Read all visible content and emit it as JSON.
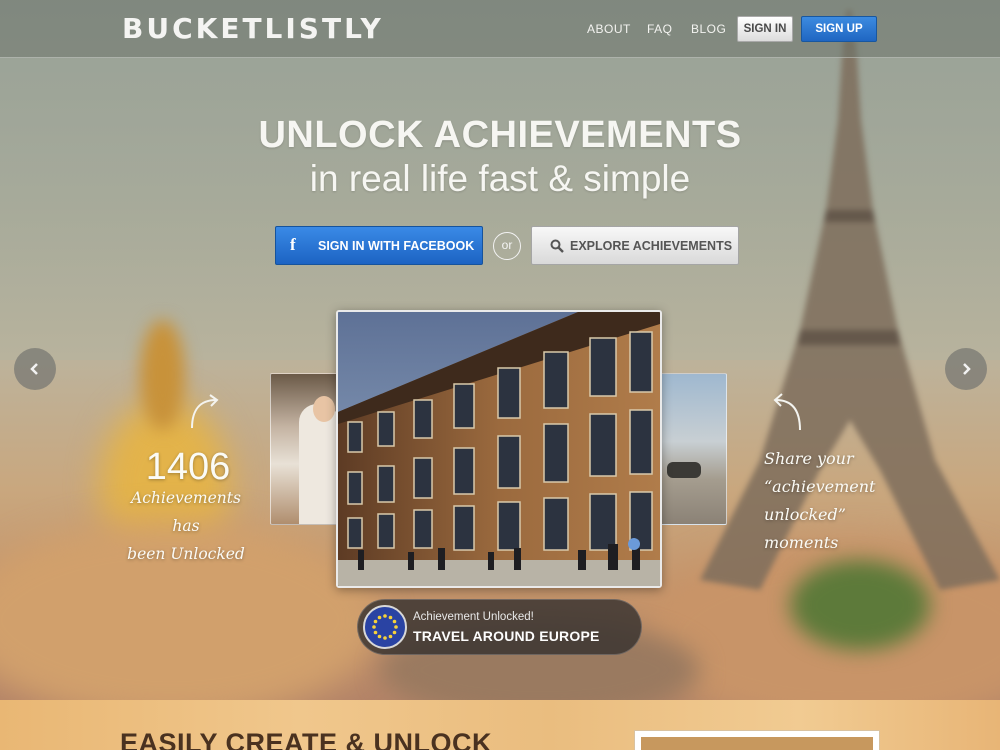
{
  "header": {
    "logo": "BUCKETLISTLY",
    "nav": [
      {
        "label": "ABOUT"
      },
      {
        "label": "FAQ"
      },
      {
        "label": "BLOG"
      }
    ],
    "sign_in": "SIGN IN",
    "sign_up": "SIGN UP"
  },
  "hero": {
    "title": "UNLOCK ACHIEVEMENTS",
    "subtitle": "in real life fast & simple",
    "facebook_button": "SIGN IN WITH FACEBOOK",
    "or": "or",
    "explore_button": "EXPLORE ACHIEVEMENTS"
  },
  "stats": {
    "count": "1406",
    "caption_line1": "Achievements has",
    "caption_line2": "been Unlocked"
  },
  "share": {
    "line1": "Share your",
    "line2": "“achievement unlocked”",
    "line3": "moments"
  },
  "badge": {
    "label": "Achievement Unlocked!",
    "title": "TRAVEL AROUND EUROPE"
  },
  "bottom": {
    "title": "EASILY CREATE & UNLOCK"
  },
  "icons": {
    "prev": "chevron-left-icon",
    "next": "chevron-right-icon",
    "facebook": "facebook-icon",
    "search": "search-icon",
    "eu_flag": "eu-flag-icon"
  },
  "colors": {
    "primary_blue": "#1f66c2",
    "header_overlay": "#6e746c",
    "text_light": "#f6f6f2",
    "badge_bg": "#37322f",
    "wood": "#eec28a"
  }
}
